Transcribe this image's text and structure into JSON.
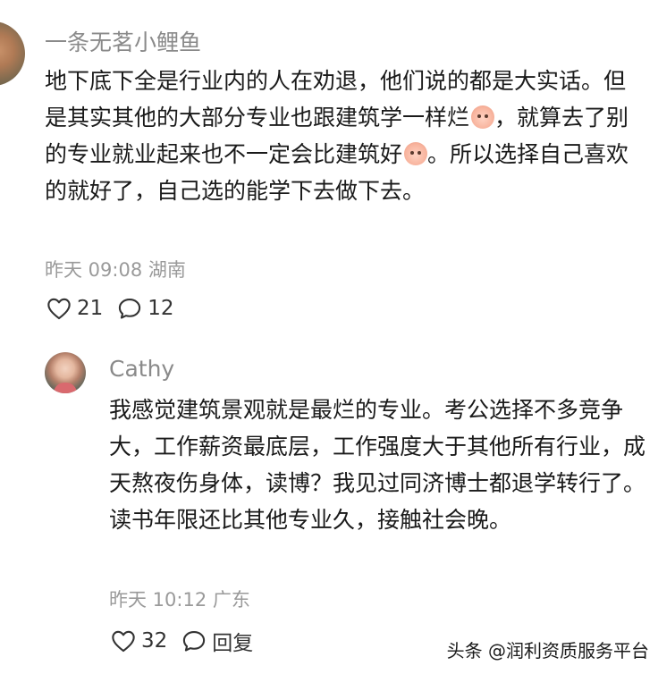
{
  "comment": {
    "username": "一条无茗小鲤鱼",
    "text_parts": [
      "地下底下全是行业内的人在劝退，他们说的都是大实话。但是其实其他的大部分专业也跟建筑学一样烂",
      "，就算去了别的专业就业起来也不一定会比建筑好",
      "。所以选择自己喜欢的就好了，自己选的能学下去做下去。"
    ],
    "meta": "昨天 09:08 湖南",
    "likes": "21",
    "replies": "12"
  },
  "reply": {
    "username": "Cathy",
    "text": "我感觉建筑景观就是最烂的专业。考公选择不多竞争大，工作薪资最底层，工作强度大于其他所有行业，成天熬夜伤身体，读博？我见过同济博士都退学转行了。读书年限还比其他专业久，接触社会晚。",
    "meta": "昨天 10:12 广东",
    "likes": "32",
    "reply_label": "回复"
  },
  "watermark": "头条 @润利资质服务平台",
  "icons": {
    "like": "heart-outline-icon",
    "comment": "speech-bubble-icon",
    "emoji": "crying-face-emoji"
  }
}
